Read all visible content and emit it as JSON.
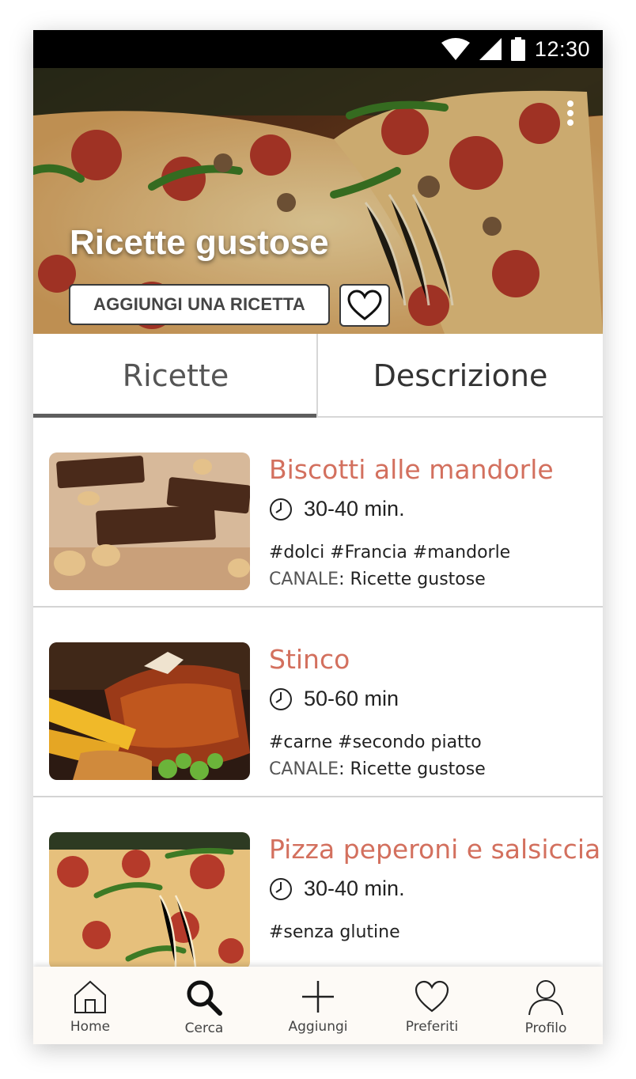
{
  "status_bar": {
    "time": "12:30"
  },
  "header": {
    "title": "Ricette gustose",
    "add_button_label": "AGGIUNGI UNA RICETTA"
  },
  "tabs": [
    {
      "label": "Ricette",
      "active": true
    },
    {
      "label": "Descrizione",
      "active": false
    }
  ],
  "recipes": [
    {
      "title": "Biscotti alle mandorle",
      "time": "30-40 min.",
      "tags": "#dolci #Francia #mandorle",
      "channel_label": "CANALE",
      "channel": "Ricette gustose"
    },
    {
      "title": "Stinco",
      "time": "50-60 min",
      "tags": "#carne #secondo piatto",
      "channel_label": "CANALE",
      "channel": "Ricette gustose"
    },
    {
      "title": "Pizza peperoni e salsiccia",
      "time": "30-40 min.",
      "tags": "#senza glutine"
    }
  ],
  "bottom_nav": [
    {
      "label": "Home",
      "icon": "home-icon"
    },
    {
      "label": "Cerca",
      "icon": "search-icon"
    },
    {
      "label": "Aggiungi",
      "icon": "plus-icon"
    },
    {
      "label": "Preferiti",
      "icon": "heart-icon"
    },
    {
      "label": "Profilo",
      "icon": "profile-icon"
    }
  ],
  "colors": {
    "accent": "#d3705e",
    "status_bar": "#000000",
    "nav_bg": "#fdfaf6"
  }
}
